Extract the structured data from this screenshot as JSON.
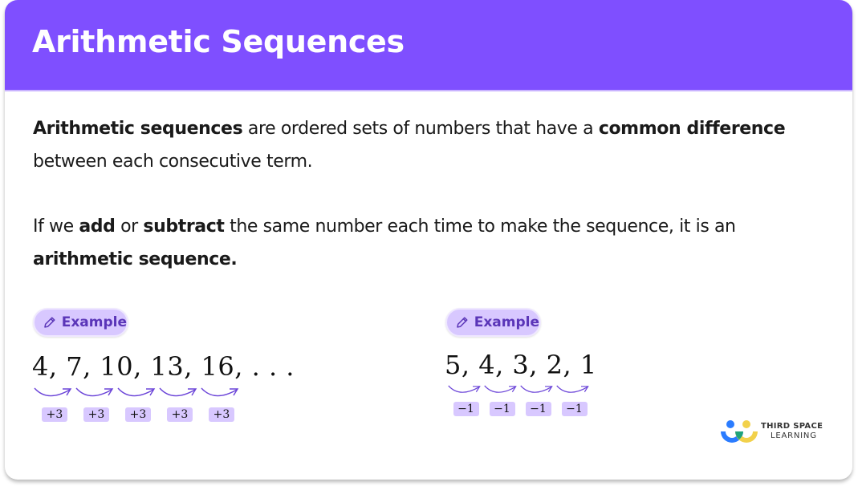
{
  "header": {
    "title": "Arithmetic Sequences",
    "color": "#7F4FFF"
  },
  "paragraph1": {
    "b1": "Arithmetic sequences",
    "t1": " are ordered sets of numbers that have a ",
    "b2": "common difference",
    "t2": " between each consecutive term."
  },
  "paragraph2": {
    "t1": "If we ",
    "b1": "add",
    "t2": " or ",
    "b2": "subtract",
    "t3": " the same number each time to make the sequence, it is an ",
    "b3": "arithmetic sequence."
  },
  "examples": [
    {
      "badge": "Example",
      "sequence": "4, 7, 10, 13, 16, . . .",
      "differences": [
        "+3",
        "+3",
        "+3",
        "+3",
        "+3"
      ]
    },
    {
      "badge": "Example",
      "sequence": "5,  4,  3,  2,  1",
      "differences": [
        "−1",
        "−1",
        "−1",
        "−1"
      ]
    }
  ],
  "logo": {
    "line1": "THIRD SPACE",
    "line2": "LEARNING"
  }
}
